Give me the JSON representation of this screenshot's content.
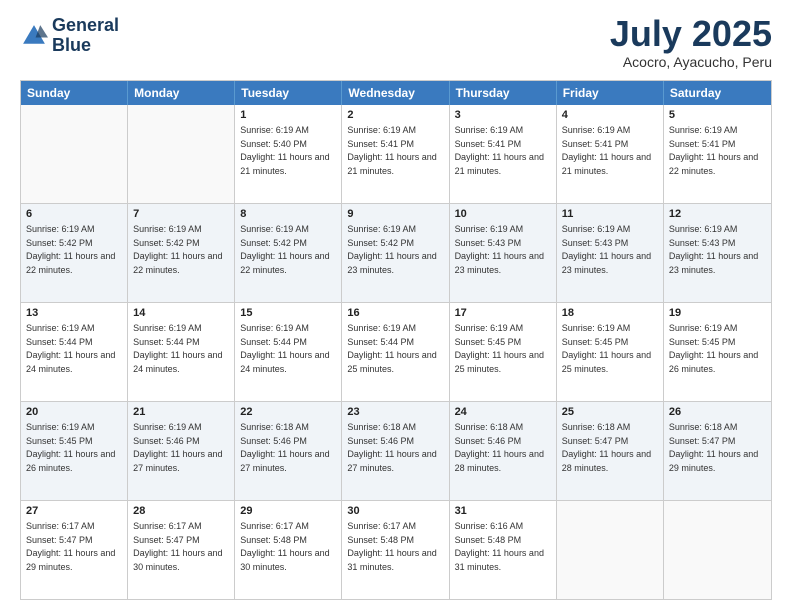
{
  "logo": {
    "line1": "General",
    "line2": "Blue"
  },
  "header": {
    "month": "July 2025",
    "location": "Acocro, Ayacucho, Peru"
  },
  "weekdays": [
    "Sunday",
    "Monday",
    "Tuesday",
    "Wednesday",
    "Thursday",
    "Friday",
    "Saturday"
  ],
  "rows": [
    [
      {
        "day": "",
        "sunrise": "",
        "sunset": "",
        "daylight": ""
      },
      {
        "day": "",
        "sunrise": "",
        "sunset": "",
        "daylight": ""
      },
      {
        "day": "1",
        "sunrise": "Sunrise: 6:19 AM",
        "sunset": "Sunset: 5:40 PM",
        "daylight": "Daylight: 11 hours and 21 minutes."
      },
      {
        "day": "2",
        "sunrise": "Sunrise: 6:19 AM",
        "sunset": "Sunset: 5:41 PM",
        "daylight": "Daylight: 11 hours and 21 minutes."
      },
      {
        "day": "3",
        "sunrise": "Sunrise: 6:19 AM",
        "sunset": "Sunset: 5:41 PM",
        "daylight": "Daylight: 11 hours and 21 minutes."
      },
      {
        "day": "4",
        "sunrise": "Sunrise: 6:19 AM",
        "sunset": "Sunset: 5:41 PM",
        "daylight": "Daylight: 11 hours and 21 minutes."
      },
      {
        "day": "5",
        "sunrise": "Sunrise: 6:19 AM",
        "sunset": "Sunset: 5:41 PM",
        "daylight": "Daylight: 11 hours and 22 minutes."
      }
    ],
    [
      {
        "day": "6",
        "sunrise": "Sunrise: 6:19 AM",
        "sunset": "Sunset: 5:42 PM",
        "daylight": "Daylight: 11 hours and 22 minutes."
      },
      {
        "day": "7",
        "sunrise": "Sunrise: 6:19 AM",
        "sunset": "Sunset: 5:42 PM",
        "daylight": "Daylight: 11 hours and 22 minutes."
      },
      {
        "day": "8",
        "sunrise": "Sunrise: 6:19 AM",
        "sunset": "Sunset: 5:42 PM",
        "daylight": "Daylight: 11 hours and 22 minutes."
      },
      {
        "day": "9",
        "sunrise": "Sunrise: 6:19 AM",
        "sunset": "Sunset: 5:42 PM",
        "daylight": "Daylight: 11 hours and 23 minutes."
      },
      {
        "day": "10",
        "sunrise": "Sunrise: 6:19 AM",
        "sunset": "Sunset: 5:43 PM",
        "daylight": "Daylight: 11 hours and 23 minutes."
      },
      {
        "day": "11",
        "sunrise": "Sunrise: 6:19 AM",
        "sunset": "Sunset: 5:43 PM",
        "daylight": "Daylight: 11 hours and 23 minutes."
      },
      {
        "day": "12",
        "sunrise": "Sunrise: 6:19 AM",
        "sunset": "Sunset: 5:43 PM",
        "daylight": "Daylight: 11 hours and 23 minutes."
      }
    ],
    [
      {
        "day": "13",
        "sunrise": "Sunrise: 6:19 AM",
        "sunset": "Sunset: 5:44 PM",
        "daylight": "Daylight: 11 hours and 24 minutes."
      },
      {
        "day": "14",
        "sunrise": "Sunrise: 6:19 AM",
        "sunset": "Sunset: 5:44 PM",
        "daylight": "Daylight: 11 hours and 24 minutes."
      },
      {
        "day": "15",
        "sunrise": "Sunrise: 6:19 AM",
        "sunset": "Sunset: 5:44 PM",
        "daylight": "Daylight: 11 hours and 24 minutes."
      },
      {
        "day": "16",
        "sunrise": "Sunrise: 6:19 AM",
        "sunset": "Sunset: 5:44 PM",
        "daylight": "Daylight: 11 hours and 25 minutes."
      },
      {
        "day": "17",
        "sunrise": "Sunrise: 6:19 AM",
        "sunset": "Sunset: 5:45 PM",
        "daylight": "Daylight: 11 hours and 25 minutes."
      },
      {
        "day": "18",
        "sunrise": "Sunrise: 6:19 AM",
        "sunset": "Sunset: 5:45 PM",
        "daylight": "Daylight: 11 hours and 25 minutes."
      },
      {
        "day": "19",
        "sunrise": "Sunrise: 6:19 AM",
        "sunset": "Sunset: 5:45 PM",
        "daylight": "Daylight: 11 hours and 26 minutes."
      }
    ],
    [
      {
        "day": "20",
        "sunrise": "Sunrise: 6:19 AM",
        "sunset": "Sunset: 5:45 PM",
        "daylight": "Daylight: 11 hours and 26 minutes."
      },
      {
        "day": "21",
        "sunrise": "Sunrise: 6:19 AM",
        "sunset": "Sunset: 5:46 PM",
        "daylight": "Daylight: 11 hours and 27 minutes."
      },
      {
        "day": "22",
        "sunrise": "Sunrise: 6:18 AM",
        "sunset": "Sunset: 5:46 PM",
        "daylight": "Daylight: 11 hours and 27 minutes."
      },
      {
        "day": "23",
        "sunrise": "Sunrise: 6:18 AM",
        "sunset": "Sunset: 5:46 PM",
        "daylight": "Daylight: 11 hours and 27 minutes."
      },
      {
        "day": "24",
        "sunrise": "Sunrise: 6:18 AM",
        "sunset": "Sunset: 5:46 PM",
        "daylight": "Daylight: 11 hours and 28 minutes."
      },
      {
        "day": "25",
        "sunrise": "Sunrise: 6:18 AM",
        "sunset": "Sunset: 5:47 PM",
        "daylight": "Daylight: 11 hours and 28 minutes."
      },
      {
        "day": "26",
        "sunrise": "Sunrise: 6:18 AM",
        "sunset": "Sunset: 5:47 PM",
        "daylight": "Daylight: 11 hours and 29 minutes."
      }
    ],
    [
      {
        "day": "27",
        "sunrise": "Sunrise: 6:17 AM",
        "sunset": "Sunset: 5:47 PM",
        "daylight": "Daylight: 11 hours and 29 minutes."
      },
      {
        "day": "28",
        "sunrise": "Sunrise: 6:17 AM",
        "sunset": "Sunset: 5:47 PM",
        "daylight": "Daylight: 11 hours and 30 minutes."
      },
      {
        "day": "29",
        "sunrise": "Sunrise: 6:17 AM",
        "sunset": "Sunset: 5:48 PM",
        "daylight": "Daylight: 11 hours and 30 minutes."
      },
      {
        "day": "30",
        "sunrise": "Sunrise: 6:17 AM",
        "sunset": "Sunset: 5:48 PM",
        "daylight": "Daylight: 11 hours and 31 minutes."
      },
      {
        "day": "31",
        "sunrise": "Sunrise: 6:16 AM",
        "sunset": "Sunset: 5:48 PM",
        "daylight": "Daylight: 11 hours and 31 minutes."
      },
      {
        "day": "",
        "sunrise": "",
        "sunset": "",
        "daylight": ""
      },
      {
        "day": "",
        "sunrise": "",
        "sunset": "",
        "daylight": ""
      }
    ]
  ]
}
